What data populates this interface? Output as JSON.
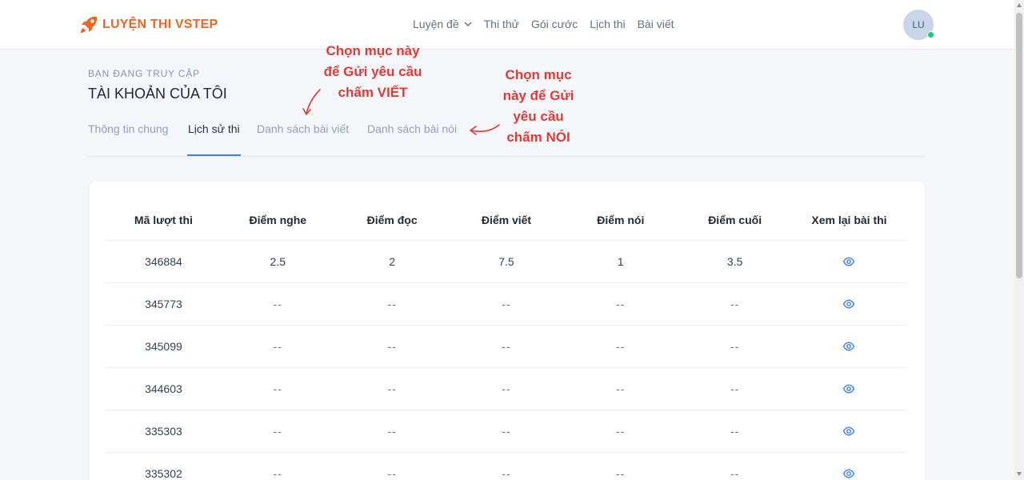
{
  "header": {
    "brand": "LUYỆN THI VSTEP",
    "nav": [
      {
        "label": "Luyện đề",
        "has_dropdown": true
      },
      {
        "label": "Thi thử"
      },
      {
        "label": "Gói cước"
      },
      {
        "label": "Lịch thi"
      },
      {
        "label": "Bài viết"
      }
    ],
    "avatar_initials": "LU"
  },
  "page": {
    "eyebrow": "BẠN ĐANG TRUY CẬP",
    "title": "TÀI KHOẢN CỦA TÔI"
  },
  "tabs": [
    {
      "label": "Thông tin chung",
      "active": false
    },
    {
      "label": "Lịch sử thi",
      "active": true
    },
    {
      "label": "Danh sách bài viết",
      "active": false
    },
    {
      "label": "Danh sách bài nói",
      "active": false
    }
  ],
  "annotations": {
    "writing": [
      "Chọn mục này",
      "để Gửi yêu cầu",
      "chấm VIẾT"
    ],
    "speaking": [
      "Chọn mục",
      "này để Gửi",
      "yêu cầu",
      "chấm NÓI"
    ],
    "color": "#e53935"
  },
  "table": {
    "columns": [
      "Mã lượt thi",
      "Điểm nghe",
      "Điểm đọc",
      "Điểm viết",
      "Điểm nói",
      "Điểm cuối",
      "Xem lại bài thi"
    ],
    "rows": [
      {
        "id": "346884",
        "listening": "2.5",
        "reading": "2",
        "writing": "7.5",
        "speaking": "1",
        "final": "3.5",
        "review_icon": "eye-icon"
      },
      {
        "id": "345773",
        "listening": "--",
        "reading": "--",
        "writing": "--",
        "speaking": "--",
        "final": "--",
        "review_icon": "eye-icon"
      },
      {
        "id": "345099",
        "listening": "--",
        "reading": "--",
        "writing": "--",
        "speaking": "--",
        "final": "--",
        "review_icon": "eye-icon"
      },
      {
        "id": "344603",
        "listening": "--",
        "reading": "--",
        "writing": "--",
        "speaking": "--",
        "final": "--",
        "review_icon": "eye-icon"
      },
      {
        "id": "335303",
        "listening": "--",
        "reading": "--",
        "writing": "--",
        "speaking": "--",
        "final": "--",
        "review_icon": "eye-icon"
      },
      {
        "id": "335302",
        "listening": "--",
        "reading": "--",
        "writing": "--",
        "speaking": "--",
        "final": "--",
        "review_icon": "eye-icon"
      }
    ]
  },
  "colors": {
    "brand": "#f06522",
    "accent": "#3b82f6",
    "online": "#1fc76b"
  }
}
